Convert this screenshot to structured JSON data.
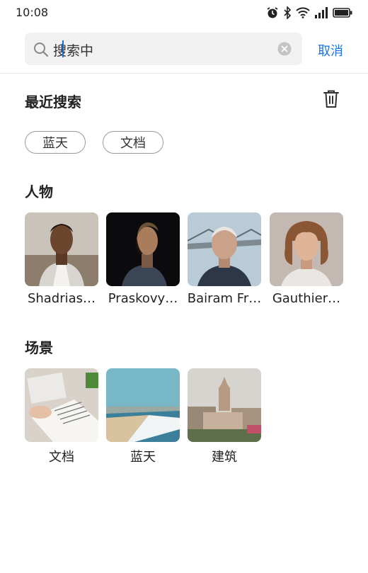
{
  "status_bar": {
    "time": "10:08",
    "icons": [
      "alarm-icon",
      "bluetooth-icon",
      "wifi-icon",
      "signal-icon",
      "battery-icon"
    ]
  },
  "search": {
    "query": "搜索中",
    "cancel_label": "取消"
  },
  "recent": {
    "title": "最近搜索",
    "chips": [
      "蓝天",
      "文档"
    ]
  },
  "people": {
    "title": "人物",
    "items": [
      {
        "name": "Shadrias…"
      },
      {
        "name": "Praskovy…"
      },
      {
        "name": "Bairam Fr…"
      },
      {
        "name": "Gauthier…"
      }
    ]
  },
  "scenes": {
    "title": "场景",
    "items": [
      {
        "name": "文档"
      },
      {
        "name": "蓝天"
      },
      {
        "name": "建筑"
      }
    ]
  },
  "colors": {
    "accent": "#1a73e8",
    "search_bg": "#f1f1f1"
  }
}
